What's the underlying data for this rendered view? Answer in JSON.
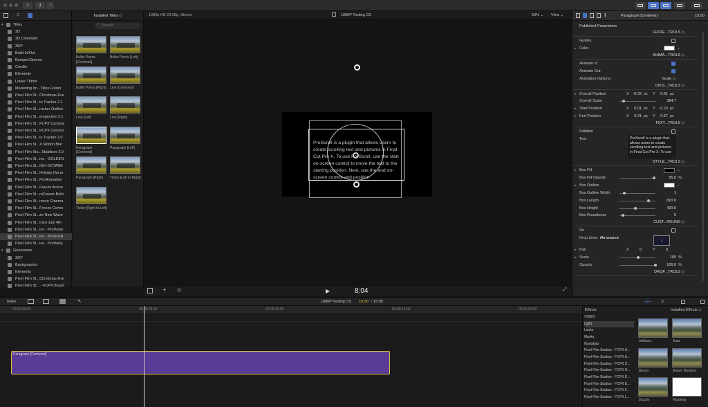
{
  "library": {
    "header_icons": [
      "film-icon",
      "music-icon",
      "titles-icon"
    ],
    "items": [
      {
        "label": "Titles",
        "type": "category",
        "expanded": true
      },
      {
        "label": "3D",
        "type": "sub"
      },
      {
        "label": "3D Cinematic",
        "type": "sub"
      },
      {
        "label": "360°",
        "type": "sub"
      },
      {
        "label": "Build In/Out",
        "type": "sub"
      },
      {
        "label": "Bumper/Opener",
        "type": "sub"
      },
      {
        "label": "Credits",
        "type": "sub"
      },
      {
        "label": "Elements",
        "type": "sub"
      },
      {
        "label": "Lower Thirds",
        "type": "sub"
      },
      {
        "label": "Marketing Im...Titles Folder",
        "type": "sub"
      },
      {
        "label": "Pixel Film St...Christmas Eve",
        "type": "sub"
      },
      {
        "label": "Pixel Film St...to Tracker 2.1",
        "type": "sub"
      },
      {
        "label": "Pixel Film St...racker Outline",
        "type": "sub"
      },
      {
        "label": "Pixel Film St...erspective 2.1",
        "type": "sub"
      },
      {
        "label": "Pixel Film St...FCPX Camera",
        "type": "sub"
      },
      {
        "label": "Pixel Film St...FCPX Colorist",
        "type": "sub"
      },
      {
        "label": "Pixel Film St...ts Tracker 2.0",
        "type": "sub"
      },
      {
        "label": "Pixel Film St...X Motion Blur",
        "type": "sub"
      },
      {
        "label": "Pixel Film Stu...Stabilizer 2.0",
        "type": "sub"
      },
      {
        "label": "Pixel Film St...ios - GOLDEN",
        "type": "sub"
      },
      {
        "label": "Pixel Film St...IGH OCTANE",
        "type": "sub"
      },
      {
        "label": "Pixel Film St...Holiday Decor",
        "type": "sub"
      },
      {
        "label": "Pixel Film St...ProAnimation",
        "type": "sub"
      },
      {
        "label": "Pixel Film St...Freeze Action",
        "type": "sub"
      },
      {
        "label": "Pixel Film St...roFreeze Bold",
        "type": "sub"
      },
      {
        "label": "Pixel Film St...reeze Cinema",
        "type": "sub"
      },
      {
        "label": "Pixel Film St...Freeze Comic",
        "type": "sub"
      },
      {
        "label": "Pixel Film St...ze New Wave",
        "type": "sub"
      },
      {
        "label": "Pixel Film St...Intro July 4th",
        "type": "sub"
      },
      {
        "label": "Pixel Film St...ios - ProPulse",
        "type": "sub"
      },
      {
        "label": "Pixel Film St...ios - ProScroll",
        "type": "sub",
        "selected": true
      },
      {
        "label": "Pixel Film St...ios - ProWarp",
        "type": "sub"
      },
      {
        "label": "Generators",
        "type": "category",
        "expanded": true
      },
      {
        "label": "360°",
        "type": "sub"
      },
      {
        "label": "Backgrounds",
        "type": "sub"
      },
      {
        "label": "Elements",
        "type": "sub"
      },
      {
        "label": "Pixel Film St...Christmas Eve",
        "type": "sub"
      },
      {
        "label": "Pixel Film St... - FCPX Brush",
        "type": "sub"
      }
    ]
  },
  "browser": {
    "title": "Installed Titles ◇",
    "search_placeholder": "Search",
    "items": [
      {
        "label": "Bullet Points [Centered]"
      },
      {
        "label": "Bullet Points [Left]"
      },
      {
        "label": "Bullet Points [Right]"
      },
      {
        "label": "Line [Centered]"
      },
      {
        "label": "Line [Left]"
      },
      {
        "label": "Line [Right]"
      },
      {
        "label": "Paragraph [Centered]",
        "selected": true
      },
      {
        "label": "Paragraph [Left]"
      },
      {
        "label": "Paragraph [Right]"
      },
      {
        "label": "Ticker [Left to Right]"
      },
      {
        "label": "Ticker [Right to Left]"
      }
    ]
  },
  "viewer": {
    "format": "1080p HD 23.98p, Stereo",
    "project": "1080P Testing CS",
    "zoom": "50% ⌄",
    "view": "View ⌄",
    "timecode": "8:04",
    "canvas_text": "ProScroll is a plugin that allows users to create scrolling text and pictures in Final Cut Pro X.  To use ProScroll, use the start on-screen control to move the text to the starting position.  Next, use the end on-screen control and position"
  },
  "inspector": {
    "title": "Paragraph [Centered]",
    "duration": "15:00",
    "published": "Published Parameters",
    "rows": [
      {
        "kind": "section",
        "label": "GUIDE...TROLS ◇"
      },
      {
        "kind": "check",
        "label": "Guides",
        "checked": false
      },
      {
        "kind": "color",
        "label": "Color",
        "arrow": true,
        "color": "#ffffff"
      },
      {
        "kind": "section",
        "label": "ANIMA...TROLS ◇"
      },
      {
        "kind": "check",
        "label": "Animate In",
        "checked": true
      },
      {
        "kind": "check",
        "label": "Animate Out",
        "checked": true
      },
      {
        "kind": "popup",
        "label": "Animation Options",
        "value": "Scale ◇"
      },
      {
        "kind": "section",
        "label": "ON-S...TROLS ◇"
      },
      {
        "kind": "xy",
        "label": "Overall Position",
        "arrow": true,
        "x": "-0.02",
        "y": "-0.01",
        "unit": "px"
      },
      {
        "kind": "slider",
        "label": "Overall Scale",
        "value": "384.7",
        "level": 0.07
      },
      {
        "kind": "xy",
        "label": "Start Position",
        "arrow": true,
        "x": "0.01",
        "y": "-0.23",
        "unit": "px"
      },
      {
        "kind": "xy",
        "label": "End Position",
        "arrow": true,
        "x": "0.01",
        "y": "0.67",
        "unit": "px"
      },
      {
        "kind": "section",
        "label": "TEXT...TROLS ◇"
      },
      {
        "kind": "check",
        "label": "Editable",
        "checked": false
      },
      {
        "kind": "text",
        "label": "Text",
        "value": "ProScroll is a plugin that allows users to create scrolling text and pictures in Final Cut Pro X.  To use"
      },
      {
        "kind": "section",
        "label": "STYLE...TROLS ◇"
      },
      {
        "kind": "color",
        "label": "Box Fill",
        "arrow": true,
        "color": "#000000"
      },
      {
        "kind": "slider",
        "label": "Box Fill Opacity",
        "value": "95.0",
        "unit": "%",
        "level": 0.95
      },
      {
        "kind": "color",
        "label": "Box Outline",
        "arrow": true,
        "color": "#ffffff"
      },
      {
        "kind": "slider",
        "label": "Box Outline Width",
        "value": "1",
        "level": 0.1
      },
      {
        "kind": "slider",
        "label": "Box Length",
        "value": "820.0",
        "level": 0.8
      },
      {
        "kind": "slider",
        "label": "Box Height",
        "value": "420.0",
        "level": 0.42
      },
      {
        "kind": "slider",
        "label": "Box Roundness",
        "value": "5",
        "level": 0.05
      },
      {
        "kind": "section",
        "label": "CUST...ROUND ◇"
      },
      {
        "kind": "check",
        "label": "On",
        "checked": false
      },
      {
        "kind": "dropzone",
        "label": "Drop Zone:",
        "value": "No source"
      },
      {
        "kind": "xy",
        "label": "Pan",
        "arrow": true,
        "x": "0",
        "y": "0",
        "unit": ""
      },
      {
        "kind": "slider",
        "label": "Scale",
        "arrow": true,
        "value": "100",
        "unit": "%",
        "level": 0.5
      },
      {
        "kind": "slider",
        "label": "Opacity",
        "value": "100.0",
        "unit": "%",
        "level": 1.0
      },
      {
        "kind": "section",
        "label": "DROP...TROLS ◇"
      }
    ]
  },
  "timeline": {
    "index": "Index",
    "project": "1080P Testing CS",
    "current": "15:00",
    "total": "/ 15:00",
    "ruler": [
      "00:00:00:00",
      "00:00:05:00",
      "00:00:10:00",
      "00:00:15:00",
      "00:00:20:00"
    ],
    "playhead_fraction": 0.35,
    "clip": {
      "name": "Paragraph [Centered]"
    }
  },
  "effects": {
    "title": "Effects",
    "installed": "Installed Effects ◇",
    "categories": [
      {
        "label": "VIDEO"
      },
      {
        "label": "Light",
        "selected": true
      },
      {
        "label": "Looks"
      },
      {
        "label": "Masks"
      },
      {
        "label": "Nostalgia"
      },
      {
        "label": "Pixel Film Studios - FCPX A..."
      },
      {
        "label": "Pixel Film Studios - FCPX A..."
      },
      {
        "label": "Pixel Film Studios - FCPX C..."
      },
      {
        "label": "Pixel Film Studios - FCPX D..."
      },
      {
        "label": "Pixel Film Studios - FCPX E..."
      },
      {
        "label": "Pixel Film Studios - FCPX E..."
      },
      {
        "label": "Pixel Film Studios - FCPX F..."
      },
      {
        "label": "Pixel Film Studios - FCPX L..."
      }
    ],
    "items": [
      {
        "label": "Artifacts"
      },
      {
        "label": "Aura"
      },
      {
        "label": "Bloom"
      },
      {
        "label": "Bokeh Random"
      },
      {
        "label": "Dazzle"
      },
      {
        "label": "Flashing"
      }
    ]
  }
}
